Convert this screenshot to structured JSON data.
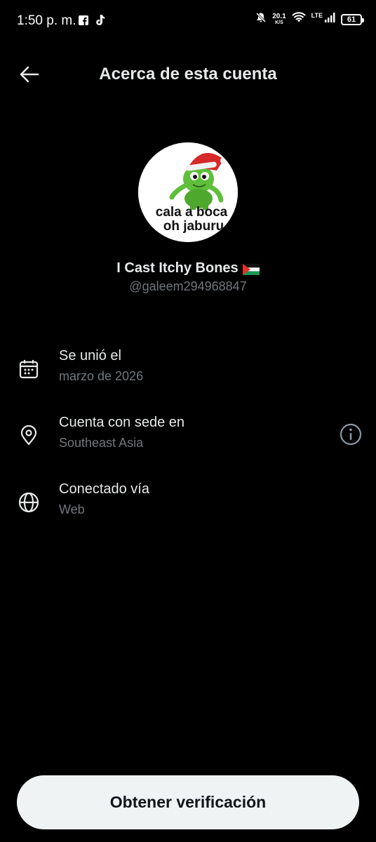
{
  "status_bar": {
    "time": "1:50 p. m.",
    "app_icons": [
      "facebook-icon",
      "tiktok-icon"
    ],
    "net_speed_value": "20.1",
    "net_speed_unit": "K/S",
    "network_type": "LTE",
    "battery_level": "61"
  },
  "header": {
    "title": "Acerca de esta cuenta",
    "back_icon": "arrow-left-icon"
  },
  "profile": {
    "avatar_caption_line1": "cala a boca",
    "avatar_caption_line2": "oh jaburu",
    "display_name": "I Cast Itchy Bones",
    "flag": "palestine-flag-emoji",
    "handle": "@galeem294968847"
  },
  "info": {
    "joined": {
      "icon": "calendar-icon",
      "title": "Se unió el",
      "value": "marzo de 2026"
    },
    "location": {
      "icon": "location-pin-icon",
      "title": "Cuenta con sede en",
      "value": "Southeast Asia",
      "info_icon": "info-circle-icon"
    },
    "connected": {
      "icon": "globe-icon",
      "title": "Conectado vía",
      "value": "Web"
    }
  },
  "footer": {
    "verify_label": "Obtener verificación"
  },
  "colors": {
    "background": "#000000",
    "primary_text": "#e7e9ea",
    "secondary_text": "#71767b",
    "button_bg": "#eff3f4",
    "button_text": "#0f1419"
  }
}
